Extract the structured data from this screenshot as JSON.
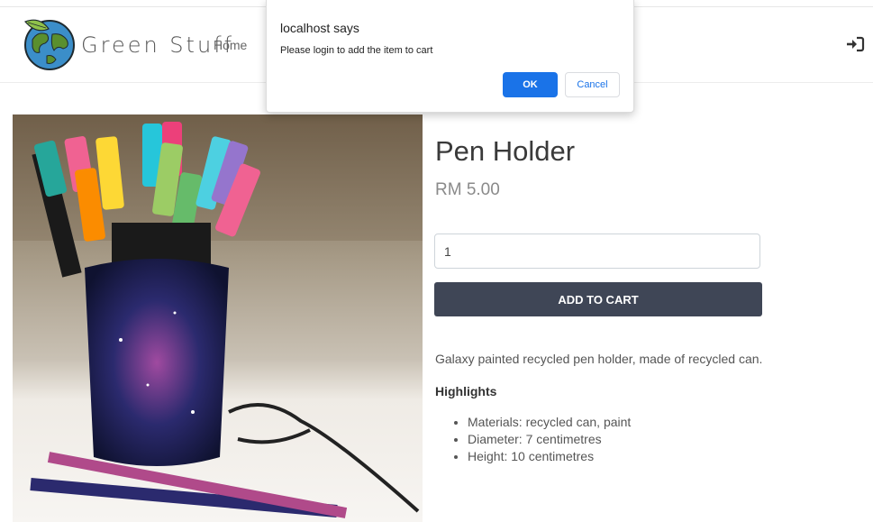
{
  "navbar": {
    "brand": "Green Stuff",
    "home_label": "Home",
    "login_icon": "sign-in-icon"
  },
  "product": {
    "title": "Pen Holder",
    "price": "RM 5.00",
    "quantity": "1",
    "add_to_cart_label": "ADD TO CART",
    "description": "Galaxy painted recycled pen holder, made of recycled can.",
    "highlights_title": "Highlights",
    "highlights": [
      "Materials: recycled can, paint",
      "Diameter: 7 centimetres",
      "Height: 10 centimetres"
    ]
  },
  "dialog": {
    "title": "localhost says",
    "message": "Please login to add the item to cart",
    "ok_label": "OK",
    "cancel_label": "Cancel"
  },
  "colors": {
    "button_dark": "#3f4656",
    "dialog_accent": "#1a73e8"
  }
}
